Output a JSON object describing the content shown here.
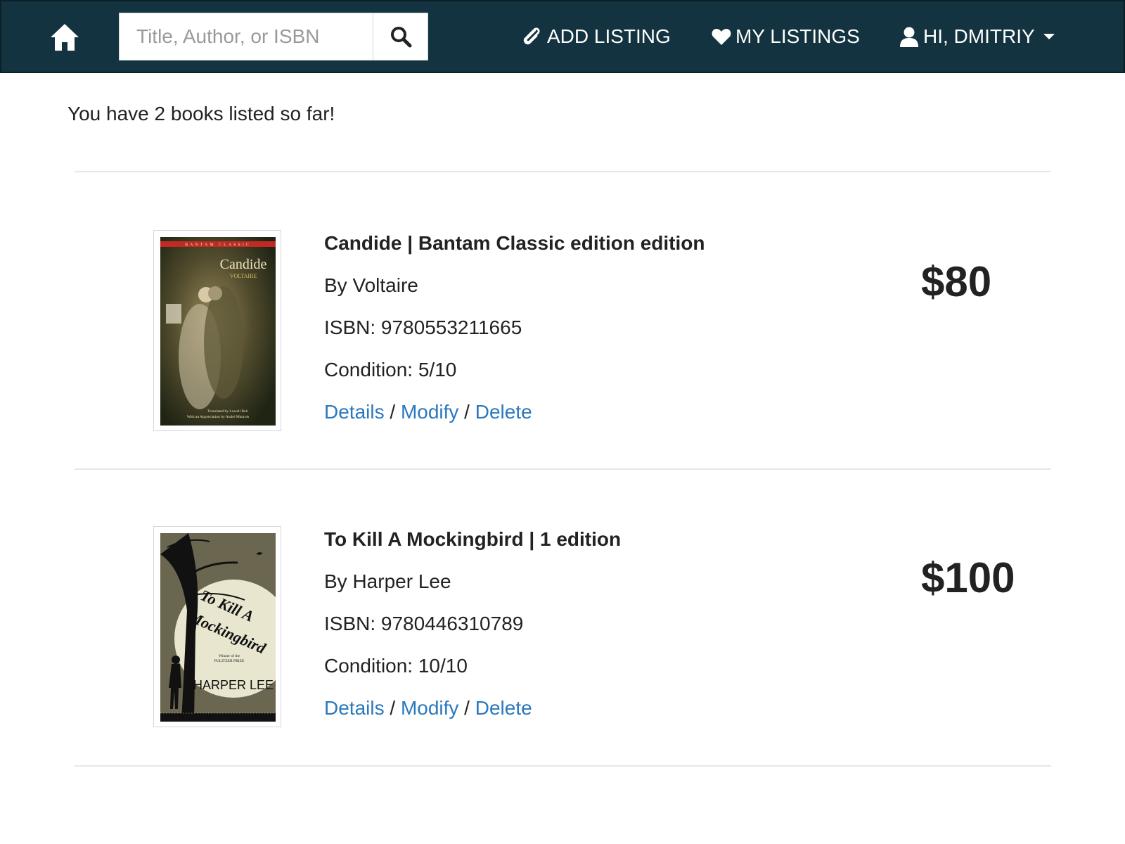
{
  "nav": {
    "search_placeholder": "Title, Author, or ISBN",
    "add_listing": "ADD LISTING",
    "my_listings": "MY LISTINGS",
    "user_greeting": "HI, DMITRIY"
  },
  "summary": "You have 2 books listed so far!",
  "listings": [
    {
      "title": "Candide | Bantam Classic edition edition",
      "author": "By Voltaire",
      "isbn": "ISBN: 9780553211665",
      "condition": "Condition: 5/10",
      "price": "$80",
      "actions": {
        "details": "Details",
        "sep1": " / ",
        "modify": "Modify",
        "sep2": " / ",
        "delete": "Delete"
      },
      "cover": {
        "series": "BANTAM CLASSIC",
        "title": "Candide",
        "author": "VOLTAIRE",
        "credit1": "Translated by Lowell Bair",
        "credit2": "With an Appreciation by André Maurois"
      }
    },
    {
      "title": "To Kill A Mockingbird | 1 edition",
      "author": "By Harper Lee",
      "isbn": "ISBN: 9780446310789",
      "condition": "Condition: 10/10",
      "price": "$100",
      "actions": {
        "details": "Details",
        "sep1": " / ",
        "modify": "Modify",
        "sep2": " / ",
        "delete": "Delete"
      },
      "cover": {
        "title_line1": "To Kill A",
        "title_line2": "Mockingbird",
        "award1": "Winner of the",
        "award2": "PULITZER PRIZE",
        "author": "HARPER LEE"
      }
    }
  ]
}
